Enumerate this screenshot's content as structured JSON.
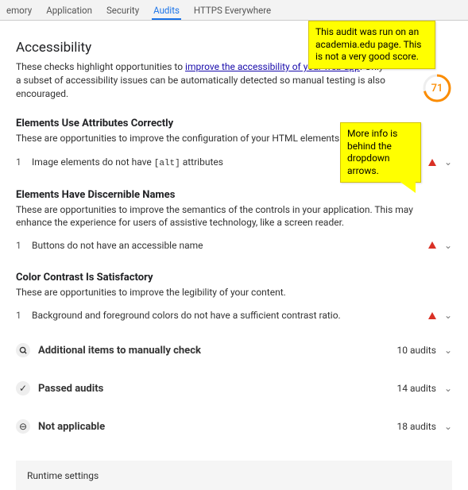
{
  "tabs": {
    "memory": "emory",
    "application": "Application",
    "security": "Security",
    "audits": "Audits",
    "https": "HTTPS Everywhere"
  },
  "callout1": "This audit was run on an academia.edu page. This is not a very good score.",
  "callout2": "More info is behind the dropdown arrows.",
  "accessibility": {
    "title": "Accessibility",
    "desc1": "These checks highlight opportunities to ",
    "link": "improve the accessibility of your web app",
    "desc2": ". Only a subset of accessibility issues can be automatically detected so manual testing is also encouraged.",
    "score": "71"
  },
  "score_color": "#fb8c00",
  "groups": [
    {
      "title": "Elements Use Attributes Correctly",
      "desc": "These are opportunities to improve the configuration of your HTML elements.",
      "num": "1",
      "audit_pre": "Image elements do not have ",
      "audit_code": "[alt]",
      "audit_post": " attributes"
    },
    {
      "title": "Elements Have Discernible Names",
      "desc": "These are opportunities to improve the semantics of the controls in your application. This may enhance the experience for users of assistive technology, like a screen reader.",
      "num": "1",
      "audit_pre": "Buttons do not have an accessible name",
      "audit_code": "",
      "audit_post": ""
    },
    {
      "title": "Color Contrast Is Satisfactory",
      "desc": "These are opportunities to improve the legibility of your content.",
      "num": "1",
      "audit_pre": "Background and foreground colors do not have a sufficient contrast ratio.",
      "audit_code": "",
      "audit_post": ""
    }
  ],
  "summaries": [
    {
      "icon": "search",
      "label": "Additional items to manually check",
      "count": "10 audits"
    },
    {
      "icon": "check",
      "label": "Passed audits",
      "count": "14 audits"
    },
    {
      "icon": "dash",
      "label": "Not applicable",
      "count": "18 audits"
    }
  ],
  "runtime": "Runtime settings"
}
